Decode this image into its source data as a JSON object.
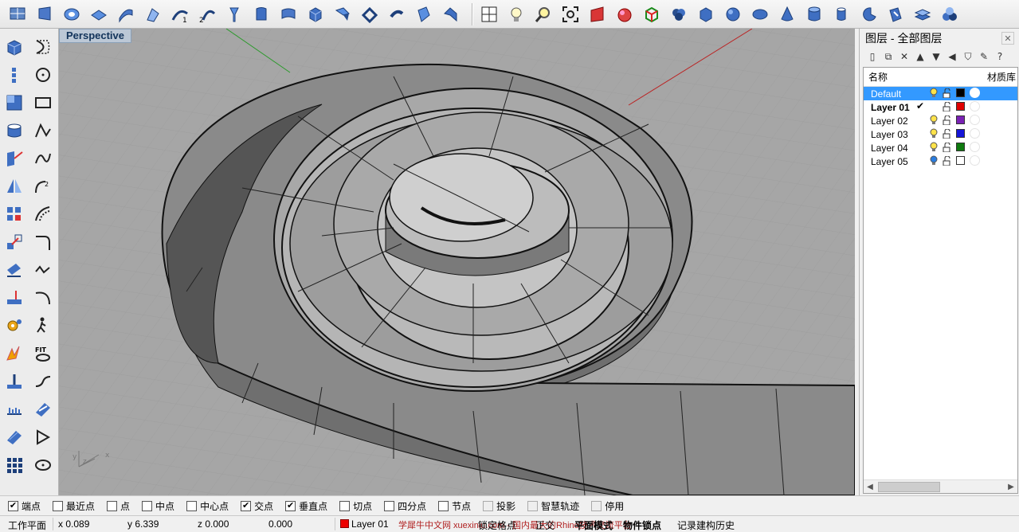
{
  "viewport": {
    "title": "Perspective",
    "axis_labels": {
      "x": "x",
      "y": "y",
      "z": "z"
    }
  },
  "layer_panel": {
    "title": "图层 - 全部图层",
    "columns": {
      "name": "名称",
      "material": "材质库"
    },
    "layers": [
      {
        "name": "Default",
        "selected": true,
        "current": false,
        "color": "#000000",
        "bulb": "yellow-bulb-icon"
      },
      {
        "name": "Layer 01",
        "selected": false,
        "current": true,
        "check": "✔",
        "color": "#e00000",
        "bulb": "none"
      },
      {
        "name": "Layer 02",
        "selected": false,
        "current": false,
        "color": "#7a22b5",
        "bulb": "yellow-bulb-icon"
      },
      {
        "name": "Layer 03",
        "selected": false,
        "current": false,
        "color": "#1515d8",
        "bulb": "yellow-bulb-icon"
      },
      {
        "name": "Layer 04",
        "selected": false,
        "current": false,
        "color": "#0f7a0f",
        "bulb": "yellow-bulb-icon"
      },
      {
        "name": "Layer 05",
        "selected": false,
        "current": false,
        "color": "#ffffff",
        "bulb": "blue-bulb-icon"
      }
    ]
  },
  "osnap": [
    {
      "label": "端点",
      "checked": true,
      "enabled": true
    },
    {
      "label": "最近点",
      "checked": false,
      "enabled": true
    },
    {
      "label": "点",
      "checked": false,
      "enabled": true
    },
    {
      "label": "中点",
      "checked": false,
      "enabled": true
    },
    {
      "label": "中心点",
      "checked": false,
      "enabled": true
    },
    {
      "label": "交点",
      "checked": true,
      "enabled": true
    },
    {
      "label": "垂直点",
      "checked": true,
      "enabled": true
    },
    {
      "label": "切点",
      "checked": false,
      "enabled": true
    },
    {
      "label": "四分点",
      "checked": false,
      "enabled": true
    },
    {
      "label": "节点",
      "checked": false,
      "enabled": true
    },
    {
      "label": "投影",
      "checked": false,
      "enabled": false
    },
    {
      "label": "智慧轨迹",
      "checked": false,
      "enabled": false
    },
    {
      "label": "停用",
      "checked": false,
      "enabled": false
    }
  ],
  "status": {
    "cplane": "工作平面",
    "x": "x 0.089",
    "y": "y 6.339",
    "z": "z 0.000",
    "distance": "0.000",
    "layer": "Layer 01",
    "grid_snap": "锁定格点",
    "ortho": "正交",
    "planar": "平面模式",
    "osnap": "物件锁点",
    "history": "记录建构历史",
    "watermark": "学犀牛中文网 xuexiniu.com - 国内最大的Rhino技术交流平台"
  }
}
